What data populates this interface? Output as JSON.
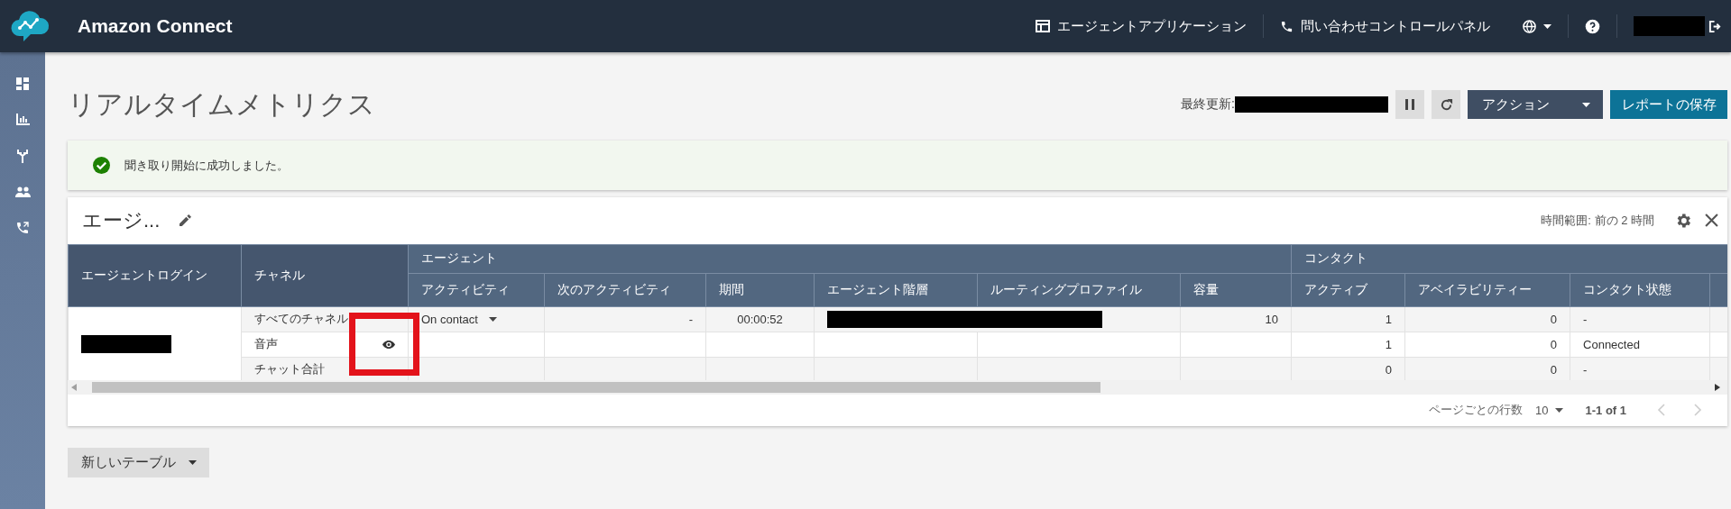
{
  "header": {
    "title": "Amazon Connect",
    "links": [
      {
        "label": "エージェントアプリケーション",
        "kind": "app"
      },
      {
        "label": "問い合わせコントロールパネル",
        "kind": "phone"
      }
    ]
  },
  "page": {
    "title": "リアルタイムメトリクス",
    "last_updated_label": "最終更新:",
    "actions_button": "アクション",
    "save_button": "レポートの保存"
  },
  "banner": {
    "message": "聞き取り開始に成功しました。"
  },
  "table_card": {
    "title": "エージ...",
    "time_range": "時間範囲: 前の 2 時間",
    "fixed_columns": [
      "エージェントログイン",
      "チャネル"
    ],
    "groups": [
      {
        "label": "エージェント",
        "columns": [
          "アクティビティ",
          "次のアクティビティ",
          "期間",
          "エージェント階層",
          "ルーティングプロファイル",
          "容量"
        ]
      },
      {
        "label": "コンタクト",
        "columns": [
          "アクティブ",
          "アベイラビリティー",
          "コンタクト状態"
        ]
      }
    ],
    "rows": [
      {
        "channel": "すべてのチャネル",
        "monitor_icon": false,
        "profile_redacted": true,
        "cells": [
          "On contact",
          "-",
          "00:00:52",
          null,
          null,
          "10",
          "1",
          "0",
          "-"
        ]
      },
      {
        "channel": "音声",
        "monitor_icon": true,
        "profile_redacted": false,
        "cells": [
          null,
          null,
          null,
          null,
          null,
          null,
          "1",
          "0",
          "Connected"
        ]
      },
      {
        "channel": "チャット合計",
        "monitor_icon": false,
        "profile_redacted": false,
        "cells": [
          null,
          null,
          null,
          null,
          null,
          null,
          "0",
          "0",
          "-"
        ]
      }
    ],
    "pagination": {
      "rows_per_page_label": "ページごとの行数",
      "rows_per_page": "10",
      "range": "1-1 of 1"
    }
  },
  "new_table_button": "新しいテーブル"
}
